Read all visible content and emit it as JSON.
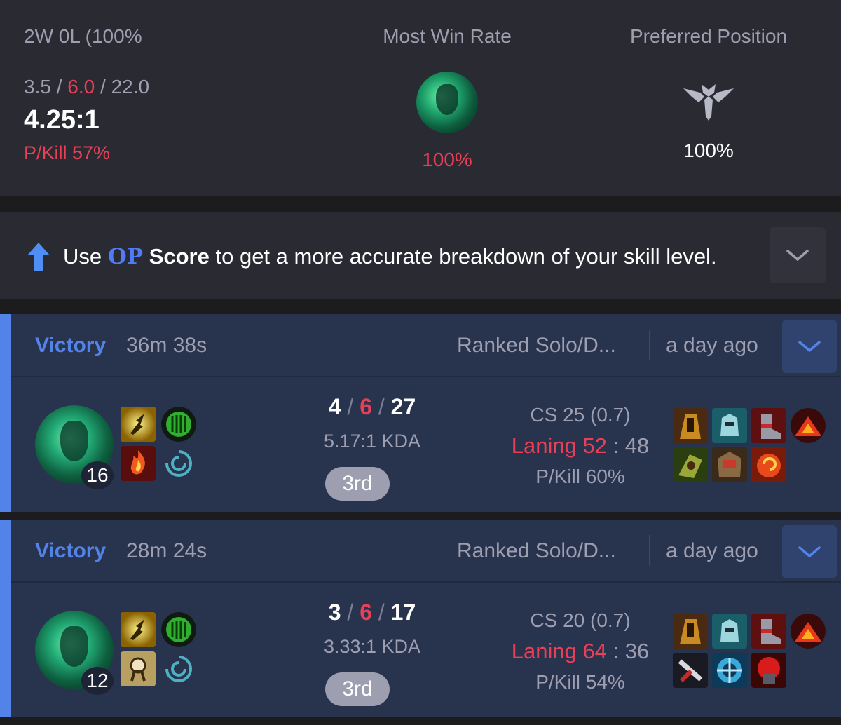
{
  "summary": {
    "record": "2W 0L (100%",
    "kills": "3.5",
    "deaths": "6.0",
    "assists": "22.0",
    "ratio": "4.25:1",
    "pkill": "P/Kill 57%",
    "most_win_rate_title": "Most Win Rate",
    "most_win_rate_pct": "100%",
    "preferred_position_title": "Preferred Position",
    "preferred_position_pct": "100%",
    "preferred_position_icon": "support-role-icon"
  },
  "op_banner": {
    "prefix": "Use ",
    "logo": "OP",
    "score": "Score",
    "suffix": " to get a more accurate breakdown of your skill level."
  },
  "matches": [
    {
      "result": "Victory",
      "duration": "36m 38s",
      "queue": "Ranked Solo/D...",
      "time_ago": "a day ago",
      "level": "16",
      "kills": "4",
      "deaths": "6",
      "assists": "27",
      "kda_ratio": "5.17:1 KDA",
      "rank": "3rd",
      "cs": "CS 25 (0.7)",
      "laning_label": "Laning",
      "laning_win": "52",
      "laning_sep": ":",
      "laning_lose": "48",
      "pkill": "P/Kill 60%"
    },
    {
      "result": "Victory",
      "duration": "28m 24s",
      "queue": "Ranked Solo/D...",
      "time_ago": "a day ago",
      "level": "12",
      "kills": "3",
      "deaths": "6",
      "assists": "17",
      "kda_ratio": "3.33:1 KDA",
      "rank": "3rd",
      "cs": "CS 20 (0.7)",
      "laning_label": "Laning",
      "laning_win": "64",
      "laning_sep": ":",
      "laning_lose": "36",
      "pkill": "P/Kill 54%"
    }
  ],
  "colors": {
    "victory": "#5383e8",
    "loss_red": "#e84057",
    "muted": "#9e9eb1"
  }
}
